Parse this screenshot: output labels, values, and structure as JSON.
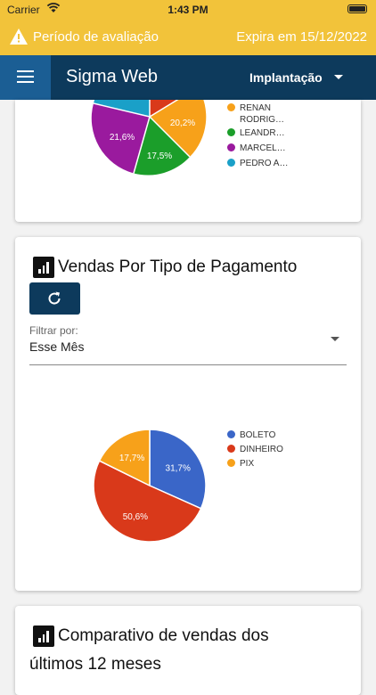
{
  "status_bar": {
    "carrier": "Carrier",
    "time": "1:43 PM"
  },
  "trial_banner": {
    "label": "Período de avaliação",
    "expiry": "Expira em 15/12/2022"
  },
  "navbar": {
    "title": "Sigma Web",
    "environment": "Implantação"
  },
  "seller_chart": {
    "chart_data": {
      "type": "pie",
      "slices": [
        {
          "label": "RENAN RODRIG…",
          "value": 20.2,
          "color": "#f7a11a"
        },
        {
          "label": "LEANDR…",
          "value": 17.5,
          "color": "#1b9e2a"
        },
        {
          "label": "MARCEL…",
          "value": 21.6,
          "color": "#9a1a9e"
        },
        {
          "label": "PEDRO A…",
          "value": null,
          "color": "#1aa0c8"
        }
      ]
    },
    "legend": [
      {
        "line1": "RENAN",
        "line2": "RODRIG…",
        "color": "#f7a11a"
      },
      {
        "line1": "LEANDR…",
        "color": "#1b9e2a"
      },
      {
        "line1": "MARCEL…",
        "color": "#9a1a9e"
      },
      {
        "line1": "PEDRO A…",
        "color": "#1aa0c8"
      }
    ],
    "slice_labels": [
      "20,2%",
      "17,5%",
      "21,6%"
    ]
  },
  "payment_card": {
    "title": "Vendas Por Tipo de Pagamento",
    "filter_label": "Filtrar por:",
    "filter_value": "Esse Mês",
    "chart_data": {
      "type": "pie",
      "slices": [
        {
          "label": "BOLETO",
          "value": 31.7,
          "color": "#3a66c8"
        },
        {
          "label": "DINHEIRO",
          "value": 50.6,
          "color": "#d9391a"
        },
        {
          "label": "PIX",
          "value": 17.7,
          "color": "#f7a11a"
        }
      ]
    },
    "slice_labels": [
      "31,7%",
      "50,6%",
      "17,7%"
    ]
  },
  "comparison_card": {
    "title_line1": "Comparativo de vendas dos",
    "title_line2": "últimos 12 meses"
  }
}
